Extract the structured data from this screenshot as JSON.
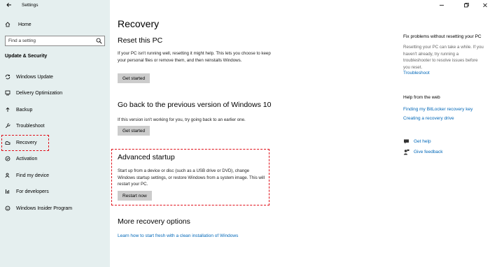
{
  "window": {
    "title": "Settings"
  },
  "sidebar": {
    "home_label": "Home",
    "search_placeholder": "Find a setting",
    "section_title": "Update & Security",
    "items": [
      {
        "label": "Windows Update",
        "icon": "sync-icon"
      },
      {
        "label": "Delivery Optimization",
        "icon": "delivery-optimization-icon"
      },
      {
        "label": "Backup",
        "icon": "backup-arrow-icon"
      },
      {
        "label": "Troubleshoot",
        "icon": "wrench-icon"
      },
      {
        "label": "Recovery",
        "icon": "recovery-icon",
        "selected": true
      },
      {
        "label": "Activation",
        "icon": "activation-check-icon"
      },
      {
        "label": "Find my device",
        "icon": "person-location-icon"
      },
      {
        "label": "For developers",
        "icon": "developer-bars-icon"
      },
      {
        "label": "Windows Insider Program",
        "icon": "insider-smiley-icon"
      }
    ]
  },
  "main": {
    "title": "Recovery",
    "reset": {
      "heading": "Reset this PC",
      "text": "If your PC isn't running well, resetting it might help. This lets you choose to keep your personal files or remove them, and then reinstalls Windows.",
      "button": "Get started"
    },
    "go_back": {
      "heading": "Go back to the previous version of Windows 10",
      "text": "If this version isn't working for you, try going back to an earlier one.",
      "button": "Get started"
    },
    "advanced": {
      "heading": "Advanced startup",
      "text": "Start up from a device or disc (such as a USB drive or DVD), change Windows startup settings, or restore Windows from a system image. This will restart your PC.",
      "button": "Restart now"
    },
    "more": {
      "heading": "More recovery options",
      "link": "Learn how to start fresh with a clean installation of Windows"
    }
  },
  "right_panel": {
    "fix_heading": "Fix problems without resetting your PC",
    "fix_text": "Resetting your PC can take a while. If you haven't already, try running a troubleshooter to resolve issues before you reset.",
    "troubleshoot_link": "Troubleshoot",
    "help_heading": "Help from the web",
    "web_links": [
      "Finding my BitLocker recovery key",
      "Creating a recovery drive"
    ],
    "get_help": "Get help",
    "give_feedback": "Give feedback"
  },
  "colors": {
    "accent_link": "#0067b8",
    "sidebar_bg": "#e5efef",
    "highlight": "#e0101a",
    "button_bg": "#cccccc"
  }
}
